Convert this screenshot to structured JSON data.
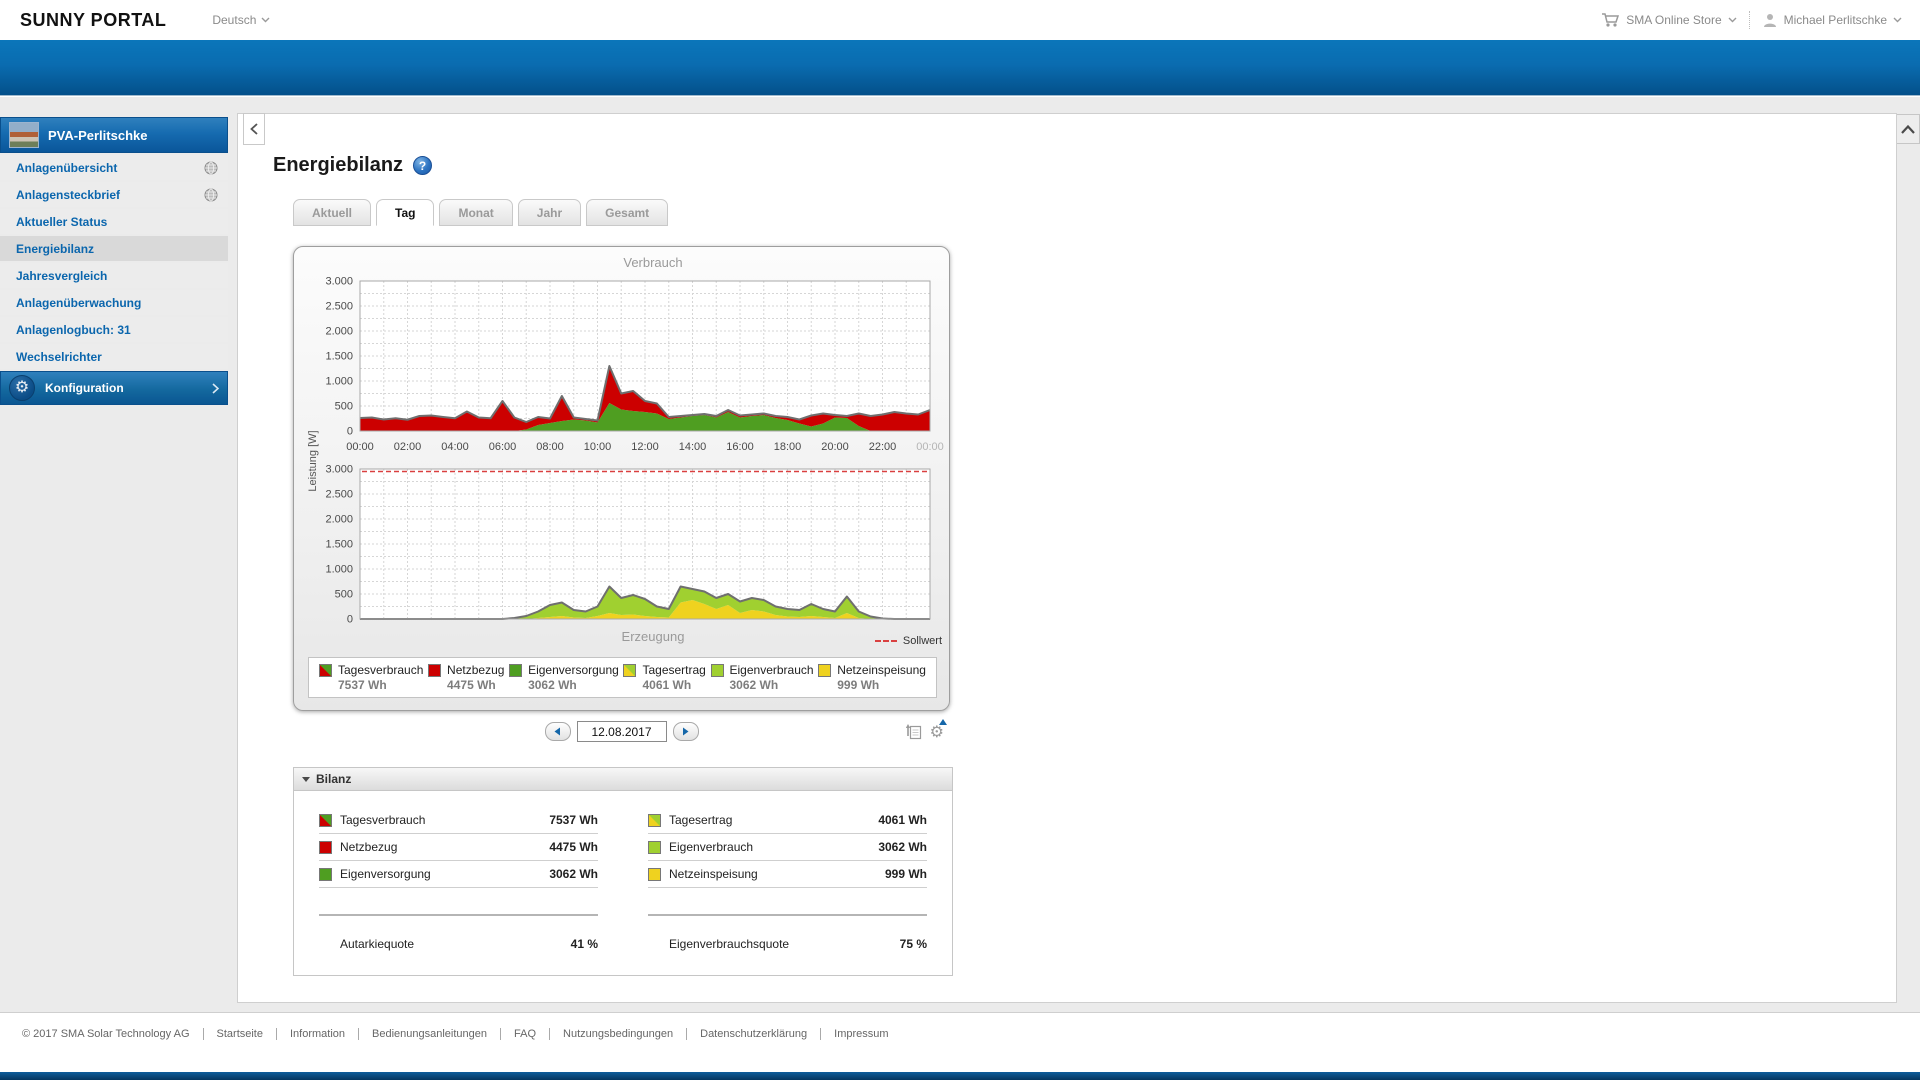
{
  "header": {
    "logo": "SUNNY PORTAL",
    "language": "Deutsch",
    "store": "SMA Online Store",
    "user": "Michael Perlitschke"
  },
  "sidebar": {
    "plant_name": "PVA-Perlitschke",
    "items": [
      {
        "key": "anlagenuebersicht",
        "label": "Anlagenübersicht",
        "icon": "globe",
        "active": false
      },
      {
        "key": "anlagensteckbrief",
        "label": "Anlagensteckbrief",
        "icon": "globe",
        "active": false
      },
      {
        "key": "aktueller-status",
        "label": "Aktueller Status",
        "icon": "",
        "active": false
      },
      {
        "key": "energiebilanz",
        "label": "Energiebilanz",
        "icon": "",
        "active": true
      },
      {
        "key": "jahresvergleich",
        "label": "Jahresvergleich",
        "icon": "",
        "active": false
      },
      {
        "key": "anlagenueberwachung",
        "label": "Anlagenüberwachung",
        "icon": "",
        "active": false
      },
      {
        "key": "anlagenlogbuch",
        "label": "Anlagenlogbuch: 31",
        "icon": "",
        "active": false
      },
      {
        "key": "wechselrichter",
        "label": "Wechselrichter",
        "icon": "",
        "active": false
      }
    ],
    "config_label": "Konfiguration"
  },
  "main": {
    "title": "Energiebilanz",
    "tabs": [
      {
        "key": "aktuell",
        "label": "Aktuell",
        "active": false
      },
      {
        "key": "tag",
        "label": "Tag",
        "active": true
      },
      {
        "key": "monat",
        "label": "Monat",
        "active": false
      },
      {
        "key": "jahr",
        "label": "Jahr",
        "active": false
      },
      {
        "key": "gesamt",
        "label": "Gesamt",
        "active": false
      }
    ],
    "date": "12.08.2017",
    "sollwert_label": "Sollwert",
    "metrics": [
      {
        "key": "tagesverbrauch",
        "label": "Tagesverbrauch",
        "value": "7537 Wh",
        "icon": "red-green"
      },
      {
        "key": "netzbezug",
        "label": "Netzbezug",
        "value": "4475 Wh",
        "icon": "red"
      },
      {
        "key": "eigenversorgung",
        "label": "Eigenversorgung",
        "value": "3062 Wh",
        "icon": "green"
      },
      {
        "key": "tagesertrag",
        "label": "Tagesertrag",
        "value": "4061 Wh",
        "icon": "green-yellow"
      },
      {
        "key": "eigenverbrauch",
        "label": "Eigenverbrauch",
        "value": "3062 Wh",
        "icon": "lightgreen"
      },
      {
        "key": "netzeinspeisung",
        "label": "Netzeinspeisung",
        "value": "999 Wh",
        "icon": "yellow"
      }
    ],
    "bilanz": {
      "title": "Bilanz",
      "left_metric_indexes": [
        0,
        1,
        2
      ],
      "right_metric_indexes": [
        3,
        4,
        5
      ],
      "left_quote": {
        "label": "Autarkiequote",
        "value": "41 %"
      },
      "right_quote": {
        "label": "Eigenverbrauchsquote",
        "value": "75 %"
      }
    }
  },
  "footer": {
    "items": [
      {
        "label": "© 2017 SMA Solar Technology AG",
        "link": false
      },
      {
        "label": "Startseite",
        "link": true
      },
      {
        "label": "Information",
        "link": true
      },
      {
        "label": "Bedienungsanleitungen",
        "link": true
      },
      {
        "label": "FAQ",
        "link": true
      },
      {
        "label": "Nutzungsbedingungen",
        "link": true
      },
      {
        "label": "Datenschutzerklärung",
        "link": true
      },
      {
        "label": "Impressum",
        "link": true
      }
    ]
  },
  "colors": {
    "red": "#cc0000",
    "green": "#4f9e21",
    "light_green": "#a0d030",
    "yellow": "#efd21f",
    "outline": "#6f6f6f",
    "sollwert": "#d94040",
    "accent_blue": "#0b66ad"
  },
  "chart_data": [
    {
      "type": "area",
      "title": "Verbrauch",
      "ylabel": "Leistung [W]",
      "ylim": [
        0,
        3000
      ],
      "yticks": [
        0,
        500,
        1000,
        1500,
        2000,
        2500,
        3000
      ],
      "ytick_labels": [
        "0",
        "500",
        "1.000",
        "1.500",
        "2.000",
        "2.500",
        "3.000"
      ],
      "xtick_labels": [
        "00:00",
        "02:00",
        "04:00",
        "06:00",
        "08:00",
        "10:00",
        "12:00",
        "14:00",
        "16:00",
        "18:00",
        "20:00",
        "22:00",
        "00:00"
      ],
      "x_start": 0,
      "x_step_hours": 0.5,
      "grid": true,
      "stack": [
        {
          "name": "Eigenversorgung",
          "color": "#4f9e21",
          "values": [
            0,
            0,
            0,
            0,
            0,
            0,
            0,
            0,
            0,
            0,
            0,
            0,
            0,
            0,
            30,
            120,
            160,
            200,
            230,
            210,
            170,
            560,
            430,
            400,
            380,
            350,
            240,
            270,
            300,
            320,
            270,
            380,
            270,
            300,
            320,
            260,
            220,
            150,
            90,
            150,
            270,
            260,
            100,
            0,
            0,
            0,
            0,
            0,
            0
          ]
        },
        {
          "name": "Netzbezug",
          "color": "#cc0000",
          "values": [
            260,
            270,
            230,
            255,
            225,
            300,
            310,
            280,
            255,
            390,
            270,
            255,
            600,
            270,
            150,
            160,
            90,
            500,
            40,
            30,
            40,
            740,
            320,
            400,
            220,
            200,
            40,
            30,
            20,
            20,
            30,
            40,
            40,
            30,
            30,
            40,
            60,
            80,
            220,
            200,
            50,
            40,
            250,
            300,
            330,
            380,
            350,
            330,
            420
          ]
        }
      ]
    },
    {
      "type": "area",
      "title": "Erzeugung",
      "ylabel": "Leistung [W]",
      "ylim": [
        0,
        3000
      ],
      "yticks": [
        0,
        500,
        1000,
        1500,
        2000,
        2500,
        3000
      ],
      "ytick_labels": [
        "0",
        "500",
        "1.000",
        "1.500",
        "2.000",
        "2.500",
        "3.000"
      ],
      "xtick_labels": [
        "00:00",
        "02:00",
        "04:00",
        "06:00",
        "08:00",
        "10:00",
        "12:00",
        "14:00",
        "16:00",
        "18:00",
        "20:00",
        "22:00",
        "00:00"
      ],
      "x_start": 0,
      "x_step_hours": 0.5,
      "grid": true,
      "sollwert": 2950,
      "sollwert_color": "#d94040",
      "stack": [
        {
          "name": "Netzeinspeisung",
          "color": "#efd21f",
          "values": [
            0,
            0,
            0,
            0,
            0,
            0,
            0,
            0,
            0,
            0,
            0,
            0,
            0,
            0,
            0,
            20,
            40,
            60,
            30,
            20,
            60,
            120,
            80,
            90,
            60,
            40,
            30,
            330,
            380,
            300,
            200,
            280,
            120,
            180,
            150,
            80,
            50,
            40,
            60,
            40,
            20,
            120,
            20,
            0,
            0,
            0,
            0,
            0,
            0
          ]
        },
        {
          "name": "Eigenverbrauch",
          "color": "#a0d030",
          "values": [
            0,
            0,
            0,
            0,
            0,
            0,
            0,
            0,
            0,
            0,
            0,
            0,
            0,
            20,
            60,
            130,
            240,
            270,
            150,
            130,
            190,
            530,
            340,
            390,
            340,
            210,
            170,
            320,
            220,
            250,
            220,
            220,
            230,
            240,
            230,
            170,
            150,
            140,
            240,
            160,
            130,
            330,
            130,
            50,
            10,
            0,
            0,
            0,
            0
          ]
        }
      ]
    }
  ]
}
